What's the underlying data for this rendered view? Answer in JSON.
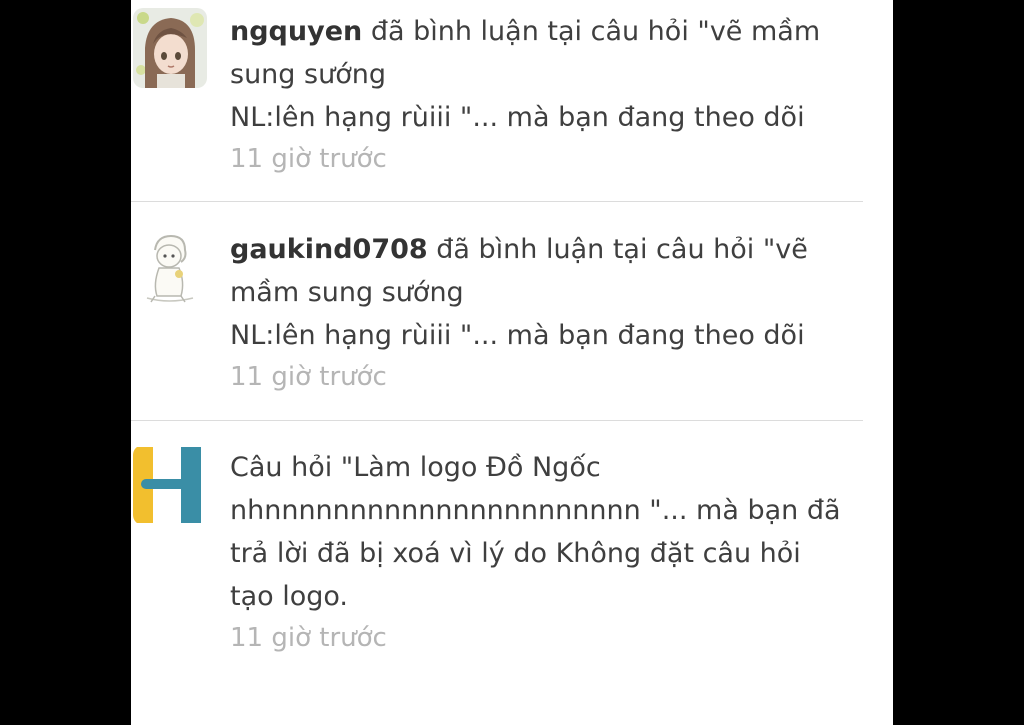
{
  "notifications": [
    {
      "user": "ngquyen",
      "action": " đã bình luận tại câu hỏi \"vẽ mầm sung sướng",
      "line2": "NL:lên hạng rùiii \"... mà bạn đang theo dõi",
      "time": "11 giờ trước",
      "avatar_icon": "anime-girl-avatar"
    },
    {
      "user": "gaukind0708",
      "action": " đã bình luận tại câu hỏi \"vẽ mầm sung sướng",
      "line2": "NL:lên hạng rùiii \"... mà bạn đang theo dõi",
      "time": "11 giờ trước",
      "avatar_icon": "cartoon-sketch-avatar"
    },
    {
      "text": "Câu hỏi \"Làm logo Đồ Ngốc nhnnnnnnnnnnnnnnnnnnnnnn \"... mà bạn đã trả lời đã bị xoá vì lý do Không đặt câu hỏi tạo logo.",
      "time": "11 giờ trước",
      "avatar_icon": "h-logo-icon"
    }
  ],
  "colors": {
    "background": "#000000",
    "panel": "#ffffff",
    "text": "#3f3f3f",
    "time": "#b5b5b5",
    "logo_yellow": "#f2bf2e",
    "logo_teal": "#3a8ea6"
  }
}
